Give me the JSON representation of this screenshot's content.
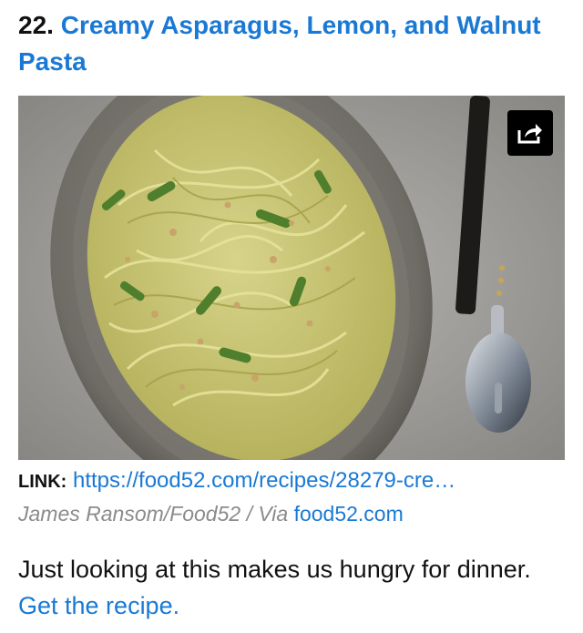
{
  "item": {
    "number": "22.",
    "title": "Creamy Asparagus, Lemon, and Walnut Pasta"
  },
  "image": {
    "alt": "Asparagus, lemon, and walnut pasta on an oval platter with a serving spoon",
    "share_icon": "share-icon"
  },
  "link": {
    "label": "LINK:",
    "url_text": "https://food52.com/recipes/28279-cre…"
  },
  "credit": {
    "text": "James Ransom/Food52 / Via ",
    "source": "food52.com"
  },
  "description": {
    "text": "Just looking at this makes us hungry for dinner. ",
    "cta": "Get the recipe."
  },
  "colors": {
    "link": "#1a79d4",
    "text": "#111111",
    "muted": "#8b8b8b"
  }
}
